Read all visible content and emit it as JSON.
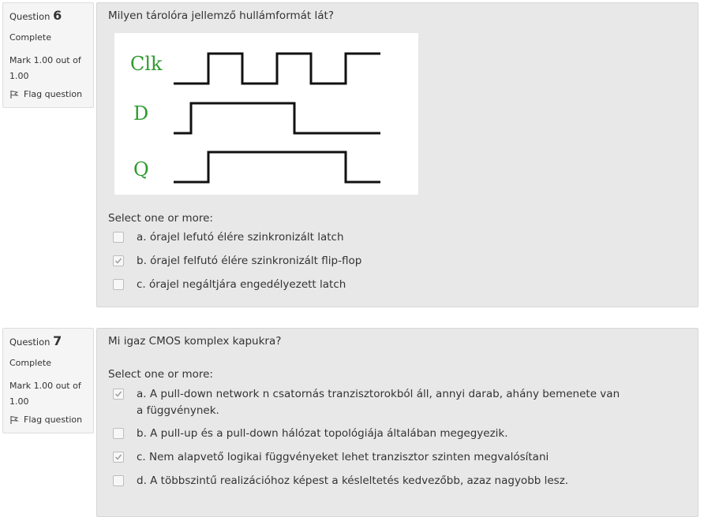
{
  "questions": [
    {
      "prefix": "Question",
      "number": "6",
      "state": "Complete",
      "mark": "Mark 1.00 out of 1.00",
      "flag_label": "Flag question",
      "text": "Milyen tárolóra jellemző hullámformát lát?",
      "figure_labels": [
        "Clk",
        "D",
        "Q"
      ],
      "select_label": "Select one or more:",
      "options": [
        {
          "label": "a. órajel lefutó élére szinkronizált latch",
          "checked": false
        },
        {
          "label": "b. órajel felfutó élére szinkronizált flip-flop",
          "checked": true
        },
        {
          "label": "c. órajel negáltjára engedélyezett latch",
          "checked": false
        }
      ]
    },
    {
      "prefix": "Question",
      "number": "7",
      "state": "Complete",
      "mark": "Mark 1.00 out of 1.00",
      "flag_label": "Flag question",
      "text": "Mi igaz CMOS komplex kapukra?",
      "select_label": "Select one or more:",
      "options": [
        {
          "label": "a. A pull-down network n csatornás tranzisztorokból áll, annyi darab, ahány bemenete van a függvénynek.",
          "checked": true
        },
        {
          "label": "b. A pull-up és a pull-down hálózat topológiája általában megegyezik.",
          "checked": false
        },
        {
          "label": "c. Nem alapvető logikai függvényeket lehet tranzisztor szinten megvalósítani",
          "checked": true
        },
        {
          "label": "d. A többszintű realizációhoz képest a késleltetés kedvezőbb, azaz nagyobb lesz.",
          "checked": false
        }
      ]
    }
  ],
  "colors": {
    "figure_label": "#2e9a2e",
    "info_bg": "#f5f5f5",
    "content_bg": "#e8e8e8"
  },
  "icons": {
    "flag": "flag-icon",
    "check": "checkmark-icon"
  }
}
